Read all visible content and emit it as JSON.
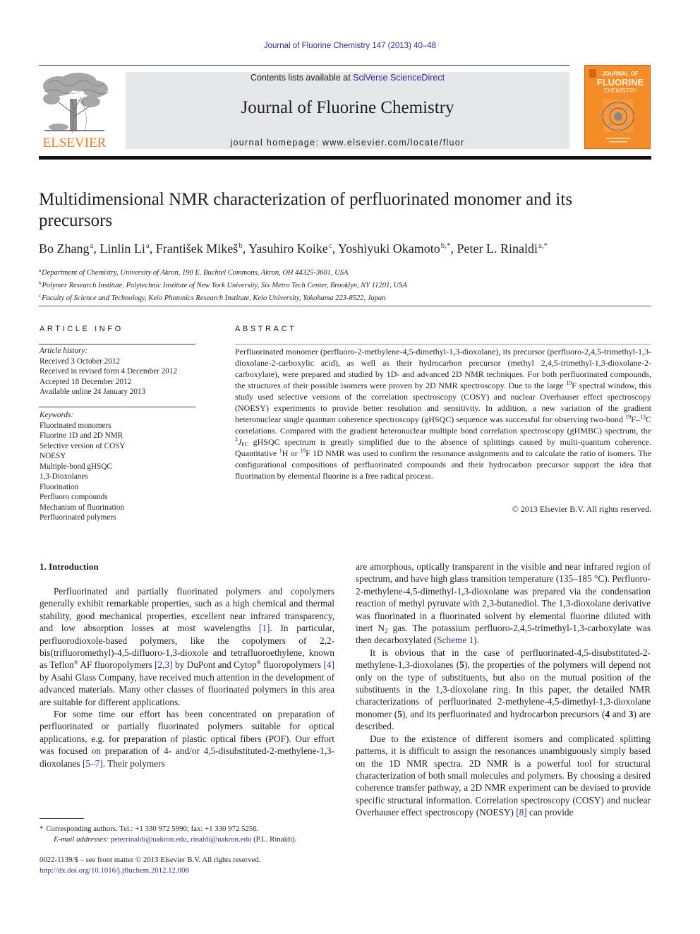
{
  "running_head": "Journal of Fluorine Chemistry 147 (2013) 40–48",
  "masthead": {
    "publisher_logo_label": "ELSEVIER",
    "contents_prefix": "Contents lists available at ",
    "contents_link": "SciVerse ScienceDirect",
    "journal_title": "Journal of Fluorine Chemistry",
    "homepage_line": "journal homepage: www.elsevier.com/locate/fluor",
    "cover": {
      "line1": "JOURNAL OF",
      "line2": "FLUORINE",
      "line3": "CHEMISTRY",
      "color": "#f48c28"
    },
    "brand_color": "#f47c20"
  },
  "article": {
    "title": "Multidimensional NMR characterization of perfluorinated monomer and its precursors",
    "authors": [
      {
        "name": "Bo Zhang",
        "sup": "a"
      },
      {
        "name": "Linlin Li",
        "sup": "a"
      },
      {
        "name": "František Mikeš",
        "sup": "b"
      },
      {
        "name": "Yasuhiro Koike",
        "sup": "c"
      },
      {
        "name": "Yoshiyuki Okamoto",
        "sup": "b,*"
      },
      {
        "name": "Peter L. Rinaldi",
        "sup": "a,*"
      }
    ],
    "affiliations": [
      {
        "key": "a",
        "text": "Department of Chemistry, University of Akron, 190 E. Buchtel Commons, Akron, OH 44325-3601, USA"
      },
      {
        "key": "b",
        "text": "Polymer Research Institute, Polytechnic Institute of New York University, Six Metro Tech Center, Brooklyn, NY 11201, USA"
      },
      {
        "key": "c",
        "text": "Faculty of Science and Technology, Keio Photonics Research Institute, Keio University, Yokohama 223-8522, Japan"
      }
    ]
  },
  "article_info": {
    "heading": "ARTICLE INFO",
    "history_label": "Article history:",
    "history": [
      "Received 3 October 2012",
      "Received in revised form 4 December 2012",
      "Accepted 18 December 2012",
      "Available online 24 January 2013"
    ],
    "keywords_label": "Keywords:",
    "keywords": [
      "Fluorinated monomers",
      "Fluorine 1D and 2D NMR",
      "Selective version of COSY",
      "NOESY",
      "Multiple-bond gHSQC",
      "1,3-Dioxolanes",
      "Fluorination",
      "Perfluoro compounds",
      "Mechanism of fluorination",
      "Perfluorinated polymers"
    ]
  },
  "abstract": {
    "heading": "ABSTRACT",
    "part1": "Perfluorinated monomer (perfluoro-2-methylene-4,5-dimethyl-1,3-dioxolane), its precursor (perfluoro-2,4,5-trimethyl-1,3-dioxolane-2-carboxylic acid), as well as their hydrocarbon precursor (methyl 2,4,5-trimethyl-1,3-dioxolane-2-carboxylate), were prepared and studied by 1D- and advanced 2D NMR techniques. For both perfluorinated compounds, the structures of their possible isomers were proven by 2D NMR spectroscopy. Due to the large ",
    "sup1": "19",
    "part2": "F spectral window, this study used selective versions of the correlation spectroscopy (COSY) and nuclear Overhauser effect spectroscopy (NOESY) experiments to provide better resolution and sensitivity. In addition, a new variation of the gradient heteronuclear single quantum coherence spectroscopy (gHSQC) sequence was successful for observing two-bond ",
    "sup2": "19",
    "part3": "F–",
    "sup3": "13",
    "part4": "C correlations. Compared with the gradient heteronuclear multiple bond correlation spectroscopy (gHMBC) spectrum, the ",
    "sup4": "2",
    "j_symbol": "J",
    "sub4": "FC",
    "part5": " gHSQC spectrum is greatly simplified due to the absence of splittings caused by multi-quantum coherence. Quantitative ",
    "sup5": "1",
    "part6": "H or ",
    "sup6": "19",
    "part7": "F 1D NMR was used to confirm the resonance assignments and to calculate the ratio of isomers. The configurational compositions of perfluorinated compounds and their hydrocarbon precursor support the idea that fluorination by elemental fluorine is a free radical process.",
    "copyright": "© 2013 Elsevier B.V. All rights reserved."
  },
  "body": {
    "section_heading": "1.  Introduction",
    "left": {
      "p1_a": "Perfluorinated and partially fluorinated polymers and copolymers generally exhibit remarkable properties, such as a high chemical and thermal stability, good mechanical properties, excellent near infrared transparency, and low absorption losses at most wavelengths ",
      "ref1": "[1]",
      "p1_b": ". In particular, perfluorodioxole-based polymers, like the copolymers of 2,2-bis(trifluoromethyl)-4,5-difluoro-1,3-dioxole and tetrafluoroethylene, known as Teflon",
      "reg": "®",
      "p1_c": " AF fluoropolymers ",
      "ref2": "[2,3]",
      "p1_d": " by DuPont and Cytop",
      "p1_e": " fluoropolymers ",
      "ref3": "[4]",
      "p1_f": " by Asahi Glass Company, have received much attention in the development of advanced materials. Many other classes of fluorinated polymers in this area are suitable for different applications.",
      "p2_a": "For some time our effort has been concentrated on preparation of perfluorinated or partially fluorinated polymers suitable for optical applications, e.g. for preparation of plastic optical fibers (POF). Our effort was focused on preparation of 4- and/or 4,5-disubstituted-2-methylene-1,3-dioxolanes ",
      "ref4": "[5–7]",
      "p2_b": ". Their polymers"
    },
    "right": {
      "p1_a": "are amorphous, optically transparent in the visible and near infrared region of spectrum, and have high glass transition temperature (135–185 °C). Perfluoro-2-methylene-4,5-dimethyl-1,3-dioxolane was prepared via the condensation reaction of methyl pyruvate with 2,3-butanediol. The 1,3-dioxolane derivative was fluorinated in a fluorinated solvent by elemental fluorine diluted with inert N",
      "sub_n": "2",
      "p1_b": " gas. The potassium perfluoro-2,4,5-trimethyl-1,3-carboxylate was then decarboxylated (",
      "scheme_ref": "Scheme 1",
      "p1_c": ").",
      "p2_a": "It is obvious that in the case of perfluorinated-4,5-disubstituted-2-methylene-1,3-dioxolanes (",
      "c5": "5",
      "p2_b": "), the properties of the polymers will depend not only on the type of substituents, but also on the mutual position of the substituents in the 1,3-dioxolane ring. In this paper, the detailed NMR characterizations of perfluorinated 2-methylene-4,5-dimethyl-1,3-dioxolane monomer (",
      "p2_c": "), and its perfluorinated and hydrocarbon precursors (",
      "c4": "4",
      "and": " and ",
      "c3": "3",
      "p2_d": ") are described.",
      "p3_a": "Due to the existence of different isomers and complicated splitting patterns, it is difficult to assign the resonances unambiguously simply based on the 1D NMR spectra. 2D NMR is a powerful tool for structural characterization of both small molecules and polymers. By choosing a desired coherence transfer pathway, a 2D NMR experiment can be devised to provide specific structural information. Correlation spectroscopy (COSY) and nuclear Overhauser effect spectroscopy (NOESY) ",
      "ref8": "[8]",
      "p3_b": " can provide"
    }
  },
  "footnotes": {
    "star": "*",
    "corresponding": "Corresponding authors. Tel.: +1 330 972 5990; fax: +1 330 972 5256.",
    "email_label": "E-mail addresses:",
    "email1": "peterrinaldi@uakron.edu",
    "email_sep": ", ",
    "email2": "rinaldi@uakron.edu",
    "email_owner": " (P.L. Rinaldi).",
    "front_matter": "0022-1139/$ – see front matter © 2013 Elsevier B.V. All rights reserved.",
    "doi": "http://dx.doi.org/10.1016/j.jfluchem.2012.12.008"
  },
  "link_color": "#2e3192"
}
